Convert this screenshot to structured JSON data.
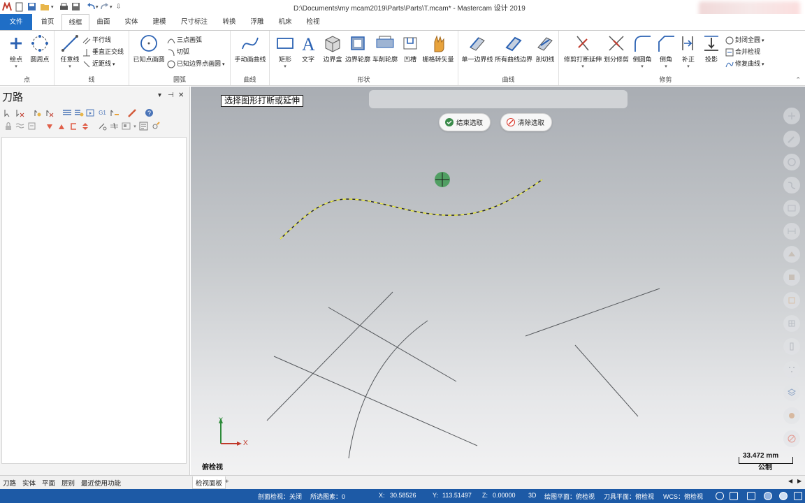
{
  "title_bar": {
    "title": "D:\\Documents\\my mcam2019\\Parts\\Parts\\T.mcam* - Mastercam 设计 2019"
  },
  "tabs": [
    {
      "label": "文件"
    },
    {
      "label": "首页"
    },
    {
      "label": "线框"
    },
    {
      "label": "曲面"
    },
    {
      "label": "实体"
    },
    {
      "label": "建模"
    },
    {
      "label": "尺寸标注"
    },
    {
      "label": "转换"
    },
    {
      "label": "浮雕"
    },
    {
      "label": "机床"
    },
    {
      "label": "检视"
    }
  ],
  "ribbon": {
    "groups": {
      "point": "点",
      "line": "线",
      "arc": "圆弧",
      "curve": "曲线",
      "shape": "形状",
      "curve2": "曲线",
      "trim": "修剪"
    },
    "point": {
      "endpoint": "绘点",
      "circle_point": "圆周点"
    },
    "line": {
      "any_line": "任意线",
      "parallel": "平行线",
      "perpendicular": "垂直正交线",
      "closest": "近距线"
    },
    "arc": {
      "known_point_circle": "已知点画圆",
      "three_point_arc": "三点画弧",
      "tangent_arc": "切弧",
      "known_edge_circle": "已知边界点画圆"
    },
    "curve": {
      "manual_curve": "手动画曲线"
    },
    "shape": {
      "rectangle": "矩形",
      "text": "文字",
      "bounding_box": "边界盒",
      "boundary_profile": "边界轮廓",
      "turn_profile": "车削轮廓",
      "groove": "凹槽",
      "grid_arrow": "栅格转矢量"
    },
    "curve2": {
      "single_edge": "单一边界线",
      "all_edges": "所有曲线边界",
      "section_line": "剖切线"
    },
    "trim": {
      "trim_break_extend": "修剪打断延伸",
      "divide_trim": "划分修剪",
      "fillet": "倒圆角",
      "chamfer": "倒角",
      "offset": "补正",
      "project": "投影",
      "close_all_arcs": "封闭全圆",
      "join_entities": "合并检视",
      "modify_curve": "修复曲线"
    }
  },
  "left_panel": {
    "title": "刀路",
    "pin": "⊣",
    "close": "✕",
    "dropdown": "▾"
  },
  "bottom_tabs": [
    {
      "label": "刀路"
    },
    {
      "label": "实体"
    },
    {
      "label": "平面"
    },
    {
      "label": "层别"
    },
    {
      "label": "最近使用功能"
    }
  ],
  "viewport": {
    "prompt": "选择图形打断或延伸",
    "end_selection": "结束选取",
    "clear_selection": "清除选取",
    "view_name": "俯检视",
    "axis_x": "X",
    "axis_y": "Y",
    "scale_value": "33.472 mm",
    "scale_unit": "公制",
    "sheet_tab": "检视面板",
    "add_tab": "+"
  },
  "status_bar": {
    "section_view": "剖面检视：关闭",
    "selected": "所选图素：0",
    "x_label": "X:",
    "x_value": "30.58526",
    "y_label": "Y:",
    "y_value": "113.51497",
    "z_label": "Z:",
    "z_value": "0.00000",
    "mode": "3D",
    "cplane": "绘图平面：俯检视",
    "tplane": "刀具平面：俯检视",
    "wcs": "WCS：俯检视"
  },
  "colors": {
    "accent": "#1f6ec6",
    "status_bar": "#1d5aa6",
    "selected_curve": "#f2f24a",
    "geometry": "#55585c"
  }
}
